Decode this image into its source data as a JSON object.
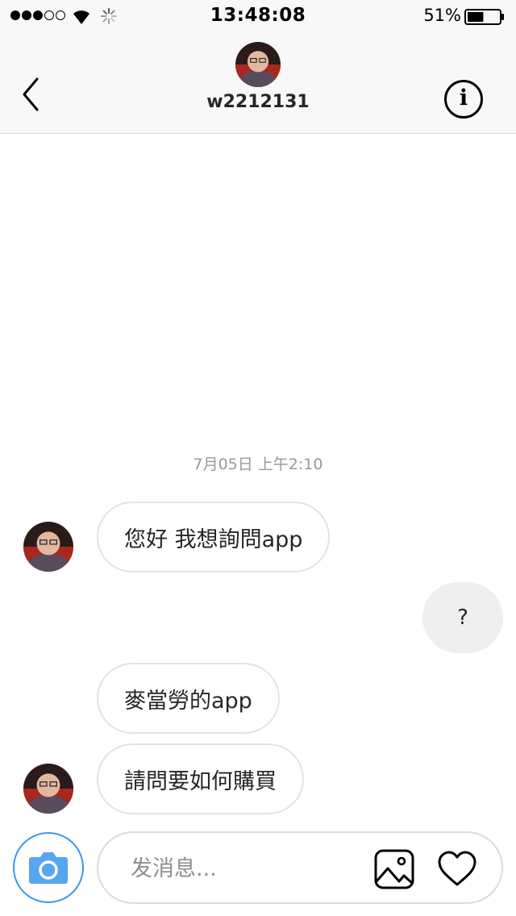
{
  "status_bar": {
    "time": "13:48:08",
    "battery_percent": "51%",
    "battery_level": 0.51,
    "signal_bars_filled": 3,
    "signal_bars_total": 5,
    "icons": [
      "signal-dots-icon",
      "wifi-icon",
      "activity-spinner-icon",
      "battery-icon"
    ]
  },
  "header": {
    "username": "w2212131",
    "icons": [
      "back-chevron-icon",
      "info-icon"
    ],
    "info_glyph": "i"
  },
  "conversation": {
    "timestamp": "7月05日 上午2:10",
    "messages": [
      {
        "sender": "them",
        "text": "您好 我想詢問app",
        "show_avatar": true
      },
      {
        "sender": "me",
        "text": "?"
      },
      {
        "sender": "them",
        "text": "麥當勞的app",
        "show_avatar": false
      },
      {
        "sender": "them",
        "text": "請問要如何購買",
        "show_avatar": true
      }
    ]
  },
  "composer": {
    "placeholder": "发消息...",
    "value": "",
    "icons": [
      "camera-icon",
      "gallery-icon",
      "heart-icon"
    ]
  },
  "colors": {
    "accent": "#3897f0",
    "bubble_border": "#e3e3e3",
    "sent_bubble_bg": "#efefef",
    "bar_bg": "#f8f8f8",
    "timestamp_text": "#999999"
  }
}
